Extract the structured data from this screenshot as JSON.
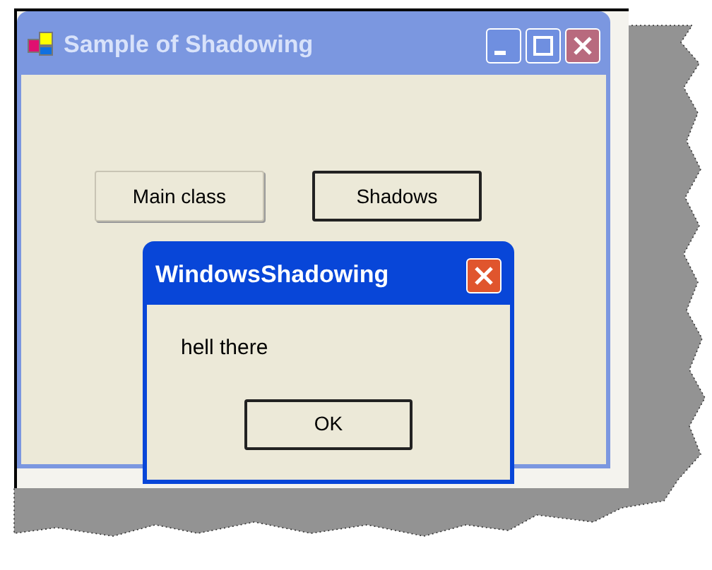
{
  "main_window": {
    "title": "Sample of Shadowing",
    "active": false,
    "buttons": [
      {
        "label": "Main class",
        "default": false
      },
      {
        "label": "Shadows",
        "default": true
      }
    ]
  },
  "dialog": {
    "title": "WindowsShadowing",
    "active": true,
    "message": "hell there",
    "buttons": [
      {
        "label": "OK",
        "default": true
      }
    ]
  }
}
